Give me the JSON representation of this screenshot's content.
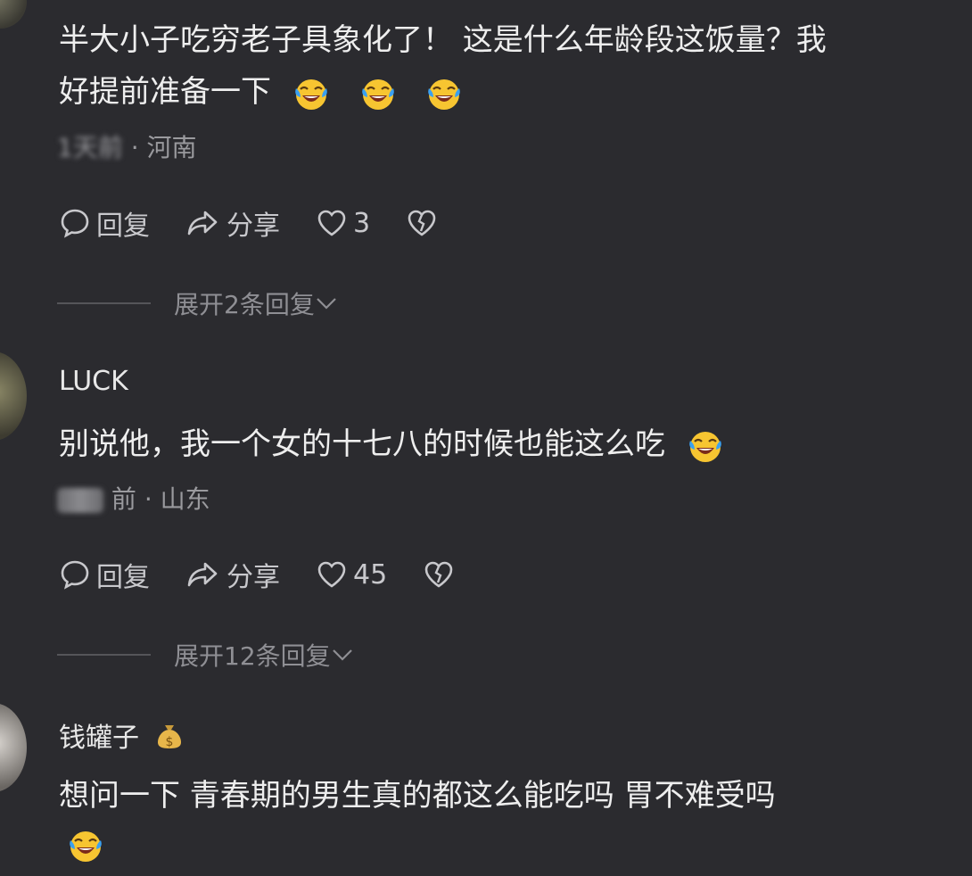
{
  "comments": [
    {
      "text_line1": "半大小子吃穷老子具象化了！ 这是什么年龄段这饭量？我",
      "text_line2": "好提前准备一下",
      "time": "1天前",
      "location": "河南",
      "reply_label": "回复",
      "share_label": "分享",
      "likes": "3",
      "expand_label": "展开2条回复"
    },
    {
      "username": "LUCK",
      "text_line1": "别说他，我一个女的十七八的时候也能这么吃",
      "time_suffix": "前",
      "location": "山东",
      "reply_label": "回复",
      "share_label": "分享",
      "likes": "45",
      "expand_label": "展开12条回复"
    },
    {
      "username": "钱罐子",
      "username_badge": "money-bag-icon",
      "text_line1": "想问一下 青春期的男生真的都这么能吃吗 胃不难受吗"
    }
  ],
  "meta_separator": "·",
  "colors": {
    "background": "#2b2b2f",
    "text": "#eeeeee",
    "meta": "#9a9a9e",
    "action": "#c8c8cc",
    "emoji_face": "#f7c531",
    "emoji_tears": "#3aa0f0"
  }
}
